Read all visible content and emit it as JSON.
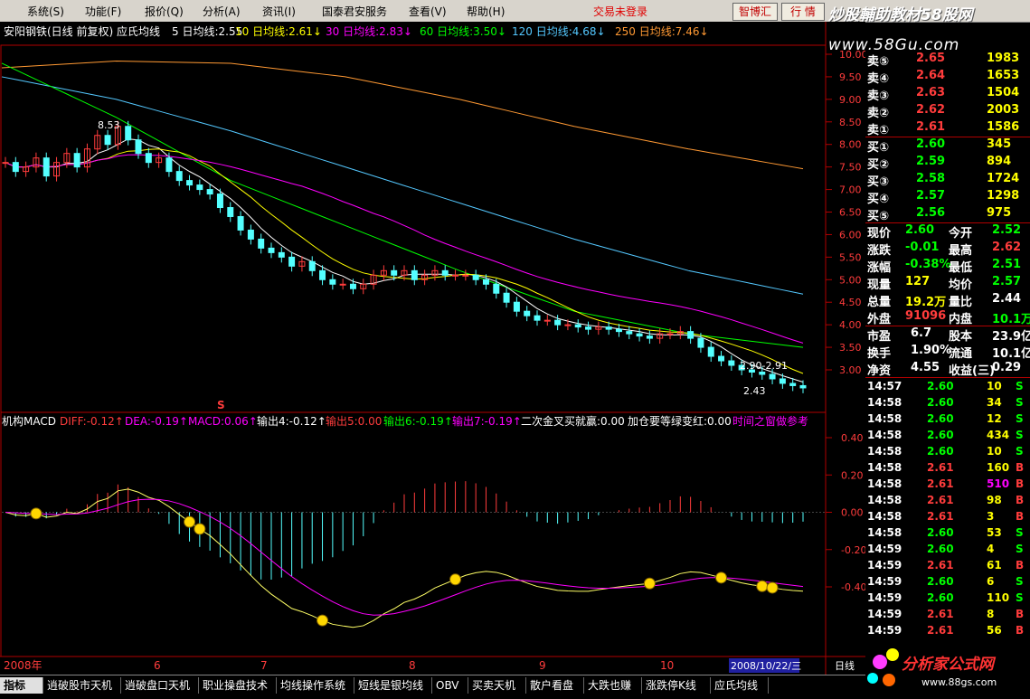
{
  "menu": {
    "items": [
      "系统(S)",
      "功能(F)",
      "报价(Q)",
      "分析(A)",
      "资讯(I)",
      "国泰君安服务",
      "查看(V)",
      "帮助(H)"
    ],
    "trade_status": "交易未登录",
    "btn_zhitouhui": "智博汇",
    "btn_hangqing": "行 情"
  },
  "brand": {
    "title": "炒股輔助教材58股网",
    "url": "www.58Gu.com"
  },
  "stock_header": {
    "name": "安阳钢铁(日线 前复权) 应氏均线",
    "ma5": "5 日均线:2.55",
    "ma10": "10 日均线:2.61↓",
    "ma30": "30 日均线:2.83↓",
    "ma60": "60 日均线:3.50↓",
    "ma120": "120 日均线:4.68↓",
    "ma250": "250 日均线:7.46↓"
  },
  "price_axis": [
    "10.00",
    "9.50",
    "9.00",
    "8.50",
    "8.00",
    "7.50",
    "7.00",
    "6.50",
    "6.00",
    "5.50",
    "5.00",
    "4.50",
    "4.00",
    "3.50",
    "3.00"
  ],
  "price_annotations": {
    "high": "8.53",
    "low": "2.43",
    "range": "2.90-2.91"
  },
  "macd_header": {
    "name": "机构MACD",
    "diff": "DIFF:-0.12↑",
    "dea": "DEA:-0.19↑",
    "macd": "MACD:0.06↑",
    "out4": "输出4:-0.12↑",
    "out5": "输出5:0.00",
    "out6": "输出6:-0.19↑",
    "out7": "输出7:-0.19↑",
    "cross": "二次金叉买就赢:0.00",
    "add": "加仓要等绿变红:0.00",
    "ref": "时间之窗做参考"
  },
  "macd_axis": [
    "0.40",
    "0.20",
    "0.00",
    "-0.20",
    "-0.40"
  ],
  "signal_s": "S",
  "date_axis": {
    "y2008": "2008年",
    "m6": "6",
    "m7": "7",
    "m8": "8",
    "m9": "9",
    "m10": "10",
    "current": "2008/10/22/三",
    "daily": "日线"
  },
  "quote": {
    "sell": [
      {
        "label": "卖⑤",
        "price": "2.65",
        "vol": "1983"
      },
      {
        "label": "卖④",
        "price": "2.64",
        "vol": "1653"
      },
      {
        "label": "卖③",
        "price": "2.63",
        "vol": "1504"
      },
      {
        "label": "卖②",
        "price": "2.62",
        "vol": "2003"
      },
      {
        "label": "卖①",
        "price": "2.61",
        "vol": "1586"
      }
    ],
    "buy": [
      {
        "label": "买①",
        "price": "2.60",
        "vol": "345"
      },
      {
        "label": "买②",
        "price": "2.59",
        "vol": "894"
      },
      {
        "label": "买③",
        "price": "2.58",
        "vol": "1724"
      },
      {
        "label": "买④",
        "price": "2.57",
        "vol": "1298"
      },
      {
        "label": "买⑤",
        "price": "2.56",
        "vol": "975"
      }
    ],
    "stats": [
      {
        "l1": "现价",
        "v1": "2.60",
        "l2": "今开",
        "v2": "2.52"
      },
      {
        "l1": "涨跌",
        "v1": "-0.01",
        "l2": "最高",
        "v2": "2.62"
      },
      {
        "l1": "涨幅",
        "v1": "-0.38%",
        "l2": "最低",
        "v2": "2.51"
      },
      {
        "l1": "现量",
        "v1": "127",
        "l2": "均价",
        "v2": "2.57"
      },
      {
        "l1": "总量",
        "v1": "19.2万",
        "l2": "量比",
        "v2": "2.44"
      },
      {
        "l1": "外盘",
        "v1": "91096",
        "l2": "内盘",
        "v2": "10.1万"
      }
    ],
    "stats2": [
      {
        "l1": "市盈",
        "v1": "6.7",
        "l2": "股本",
        "v2": "23.9亿"
      },
      {
        "l1": "换手",
        "v1": "1.90%",
        "l2": "流通",
        "v2": "10.1亿"
      },
      {
        "l1": "净资",
        "v1": "4.55",
        "l2": "收益(三)",
        "v2": "0.29"
      }
    ]
  },
  "ticks": [
    {
      "t": "14:57",
      "p": "2.60",
      "v": "10",
      "s": "S"
    },
    {
      "t": "14:58",
      "p": "2.60",
      "v": "34",
      "s": "S"
    },
    {
      "t": "14:58",
      "p": "2.60",
      "v": "12",
      "s": "S"
    },
    {
      "t": "14:58",
      "p": "2.60",
      "v": "434",
      "s": "S"
    },
    {
      "t": "14:58",
      "p": "2.60",
      "v": "10",
      "s": "S"
    },
    {
      "t": "14:58",
      "p": "2.61",
      "v": "160",
      "s": "B"
    },
    {
      "t": "14:58",
      "p": "2.61",
      "v": "510",
      "s": "B"
    },
    {
      "t": "14:58",
      "p": "2.61",
      "v": "98",
      "s": "B"
    },
    {
      "t": "14:58",
      "p": "2.61",
      "v": "3",
      "s": "B"
    },
    {
      "t": "14:58",
      "p": "2.60",
      "v": "53",
      "s": "S"
    },
    {
      "t": "14:59",
      "p": "2.60",
      "v": "4",
      "s": "S"
    },
    {
      "t": "14:59",
      "p": "2.61",
      "v": "61",
      "s": "B"
    },
    {
      "t": "14:59",
      "p": "2.60",
      "v": "6",
      "s": "S"
    },
    {
      "t": "14:59",
      "p": "2.60",
      "v": "110",
      "s": "S"
    },
    {
      "t": "14:59",
      "p": "2.61",
      "v": "8",
      "s": "B"
    },
    {
      "t": "14:59",
      "p": "2.61",
      "v": "56",
      "s": "B"
    }
  ],
  "tabs": [
    "指标",
    "逍破股市天机",
    "逍破盘口天机",
    "职业操盘技术",
    "均线操作系统",
    "短线是银均线",
    "OBV",
    "买卖天机",
    "散户看盘",
    "大跌也赚",
    "涨跌停K线",
    "应氏均线"
  ],
  "logo2": {
    "title": "分析家公式网",
    "url": "www.88gs.com"
  },
  "colors": {
    "up": "#ff3c3c",
    "down": "#54ffff",
    "ma5": "#ffffff",
    "ma10": "#ffff00",
    "ma30": "#ff00ff",
    "ma60": "#00ff00",
    "ma120": "#54c8ff",
    "ma250": "#ff9933"
  },
  "chart_data": {
    "type": "line",
    "title": "安阳钢铁(日线 前复权) 应氏均线",
    "series": [
      {
        "name": "120日均线",
        "values": [
          9.5,
          9.0,
          8.3,
          7.5,
          6.7,
          5.9,
          5.2,
          4.68
        ]
      },
      {
        "name": "250日均线",
        "values": [
          9.7,
          9.85,
          9.8,
          9.5,
          9.0,
          8.4,
          7.9,
          7.46
        ]
      },
      {
        "name": "60日均线",
        "values": [
          9.8,
          8.6,
          7.2,
          6.2,
          5.2,
          4.3,
          3.8,
          3.5
        ]
      }
    ],
    "ylim": [
      2.4,
      10.0
    ]
  }
}
